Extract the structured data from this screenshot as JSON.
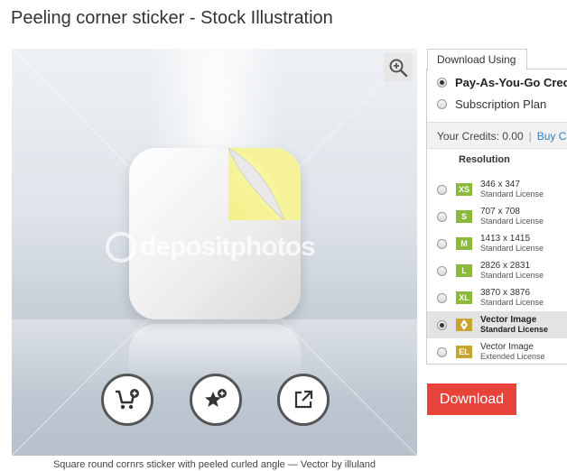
{
  "page": {
    "title": "Peeling corner sticker - Stock Illustration",
    "caption": "Square round cornrs sticker with peeled curled angle — Vector by illuland"
  },
  "preview": {
    "watermark": "depositphotos",
    "zoom_icon": "zoom-in-icon",
    "actions": [
      {
        "name": "add-to-cart-button",
        "icon": "cart-plus-icon"
      },
      {
        "name": "add-to-favorites-button",
        "icon": "star-plus-icon"
      },
      {
        "name": "share-button",
        "icon": "share-external-icon"
      }
    ]
  },
  "download_panel": {
    "tab_label": "Download Using",
    "options": [
      {
        "label": "Pay-As-You-Go Credits",
        "selected": true
      },
      {
        "label": "Subscription Plan",
        "selected": false
      }
    ],
    "credits_label": "Your Credits: 0.00",
    "separator": "|",
    "buy_link": "Buy Credits",
    "resolution_header": "Resolution",
    "resolutions": [
      {
        "badge": "XS",
        "size": "346 x 347",
        "license": "Standard License",
        "selected": false
      },
      {
        "badge": "S",
        "size": "707 x 708",
        "license": "Standard License",
        "selected": false
      },
      {
        "badge": "M",
        "size": "1413 x 1415",
        "license": "Standard License",
        "selected": false
      },
      {
        "badge": "L",
        "size": "2826 x 2831",
        "license": "Standard License",
        "selected": false
      },
      {
        "badge": "XL",
        "size": "3870 x 3876",
        "license": "Standard License",
        "selected": false
      },
      {
        "badge": "",
        "size": "Vector Image",
        "license": "Standard License",
        "selected": true
      },
      {
        "badge": "EL",
        "size": "Vector Image",
        "license": "Extended License",
        "selected": false
      }
    ],
    "download_label": "Download"
  },
  "colors": {
    "accent_red": "#e8433a",
    "badge_green": "#8cb83c",
    "badge_gold": "#c8a533",
    "link_blue": "#2d7fc1"
  }
}
